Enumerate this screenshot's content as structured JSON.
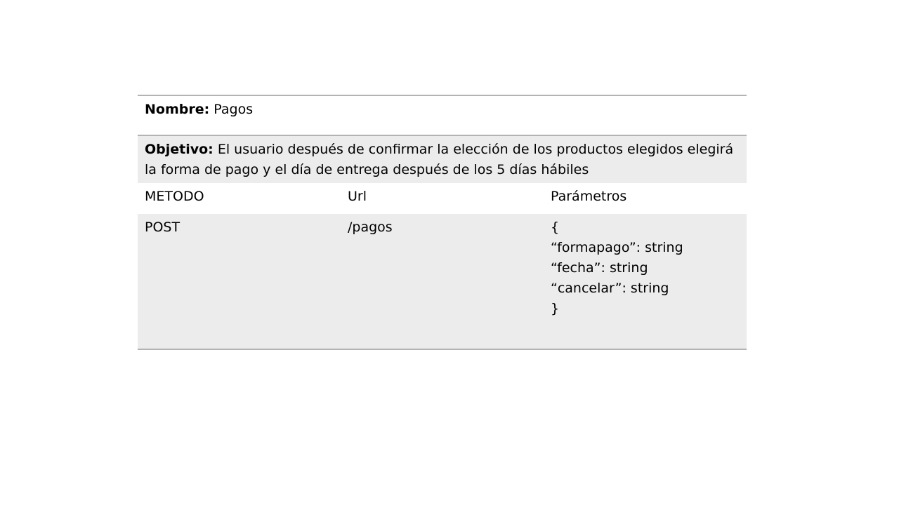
{
  "name_row": {
    "label": "Nombre:",
    "value": " Pagos"
  },
  "objective_row": {
    "label": "Objetivo:",
    "value": " El usuario después de confirmar la elección de los productos elegidos elegirá la forma de pago y el día de entrega después de los 5 días hábiles"
  },
  "columns": {
    "method": "METODO",
    "url": "Url",
    "params": "Parámetros"
  },
  "endpoint": {
    "method": "POST",
    "url": "/pagos",
    "params": [
      "{",
      "“formapago”: string",
      "“fecha”: string",
      "“cancelar”: string",
      "}"
    ]
  }
}
